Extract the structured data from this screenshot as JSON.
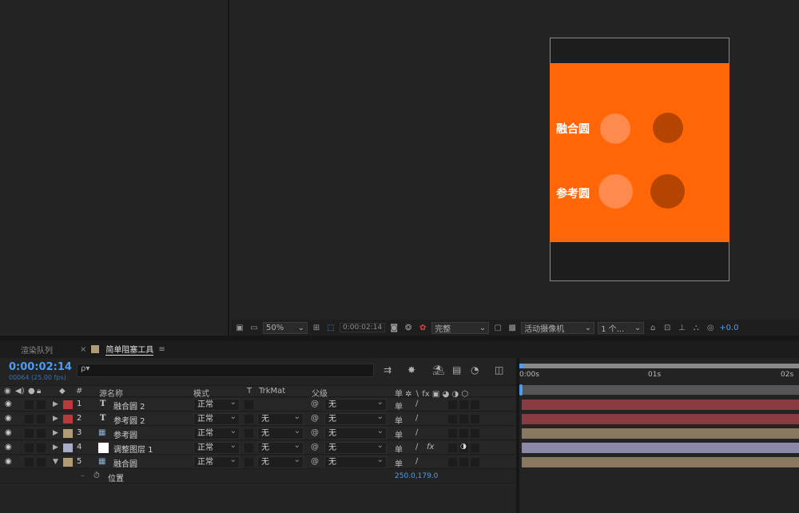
{
  "viewer": {
    "labels": {
      "blend": "融合圆",
      "reference": "参考圆"
    }
  },
  "viewer_bar": {
    "zoom": "50%",
    "timecode": "0:00:02:14",
    "resolution": "完整",
    "camera": "活动摄像机",
    "views": "1 个...",
    "exposure": "+0.0"
  },
  "panel_tabs": {
    "render_queue": "渲染队列",
    "close": "×",
    "comp": "简单阻塞工具",
    "menu": "≡"
  },
  "timeline": {
    "timecode": "0:00:02:14",
    "frames": "00064 (25.00 fps)",
    "search_placeholder": "ρ▾",
    "columns": {
      "hash": "#",
      "source": "源名称",
      "mode": "模式",
      "t": "T",
      "trkmat": "TrkMat",
      "parent": "父级",
      "switches": "单 ✲ ∖ fx ▣ ◕ ◑ ⬡"
    },
    "ruler": {
      "t0": "0:00s",
      "t1": "01s",
      "t2": "02s"
    },
    "layers": [
      {
        "num": "1",
        "type": "T",
        "name": "融合圆 2",
        "color": "#b83a3a",
        "mode": "正常",
        "trkmat": "",
        "parent": "无",
        "fx": ""
      },
      {
        "num": "2",
        "type": "T",
        "name": "参考圆 2",
        "color": "#b83a3a",
        "mode": "正常",
        "trkmat": "无",
        "parent": "无",
        "fx": ""
      },
      {
        "num": "3",
        "type": "comp",
        "name": "参考圆",
        "color": "#b29c74",
        "mode": "正常",
        "trkmat": "无",
        "parent": "无",
        "fx": ""
      },
      {
        "num": "4",
        "type": "solid",
        "name": "调整图层 1",
        "color": "#a9acc9",
        "mode": "正常",
        "trkmat": "无",
        "parent": "无",
        "fx": "fx"
      },
      {
        "num": "5",
        "type": "comp",
        "name": "融合圆",
        "color": "#b29c74",
        "mode": "正常",
        "trkmat": "无",
        "parent": "无",
        "fx": ""
      }
    ],
    "property": {
      "name": "位置",
      "value": "250.0,179.0"
    }
  },
  "colors": {
    "comp_bg": "#ff6607",
    "accent": "#4a9cf5"
  }
}
